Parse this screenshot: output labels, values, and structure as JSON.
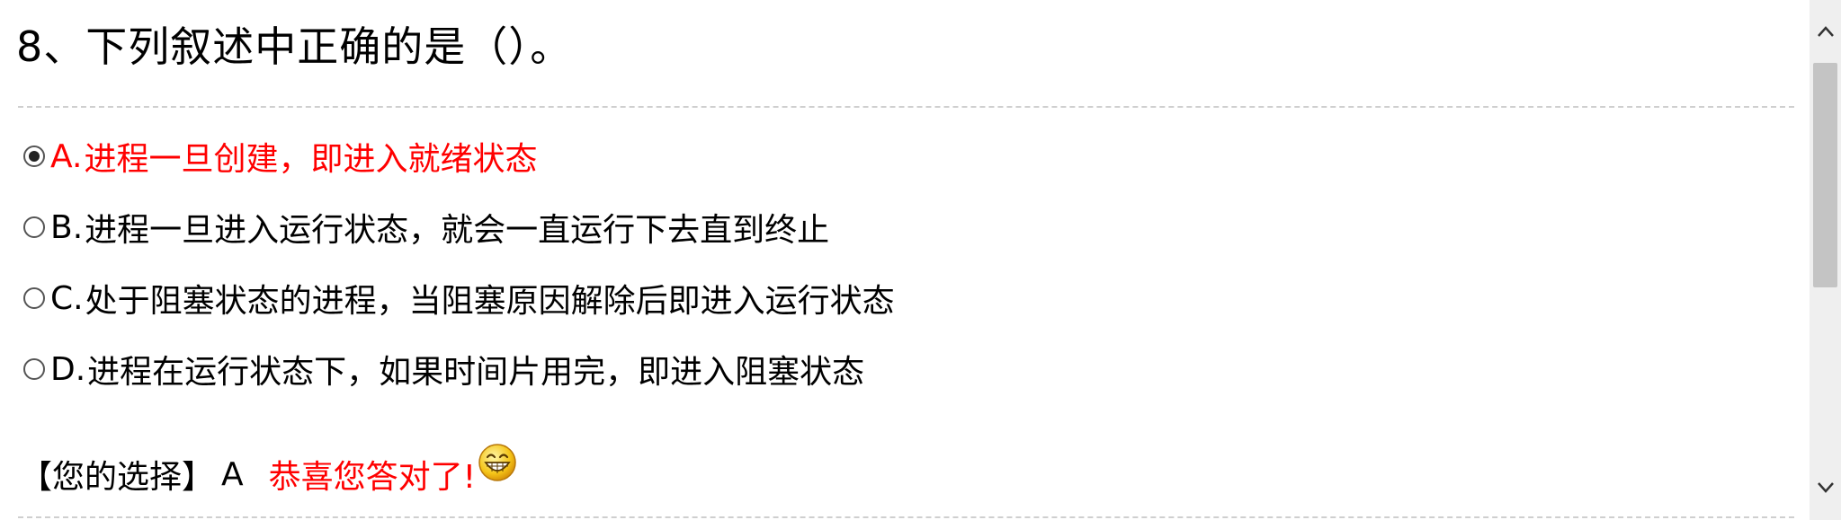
{
  "question": {
    "title": "8、下列叙述中正确的是（）。"
  },
  "options": [
    {
      "letter": "A.",
      "text": "进程一旦创建，即进入就绪状态",
      "selected": true
    },
    {
      "letter": "B.",
      "text": "进程一旦进入运行状态，就会一直运行下去直到终止",
      "selected": false
    },
    {
      "letter": "C.",
      "text": "处于阻塞状态的进程，当阻塞原因解除后即进入运行状态",
      "selected": false
    },
    {
      "letter": "D.",
      "text": "进程在运行状态下，如果时间片用完，即进入阻塞状态",
      "selected": false
    }
  ],
  "result": {
    "label": "【您的选择】",
    "choice": "A",
    "message": "恭喜您答对了!",
    "emoji": "grinning-face-icon"
  },
  "colors": {
    "selected": "#ff0000",
    "text": "#000000",
    "divider": "#cfcfcf",
    "scrollbar_track": "#efefef",
    "scrollbar_thumb": "#c4c4c4"
  }
}
